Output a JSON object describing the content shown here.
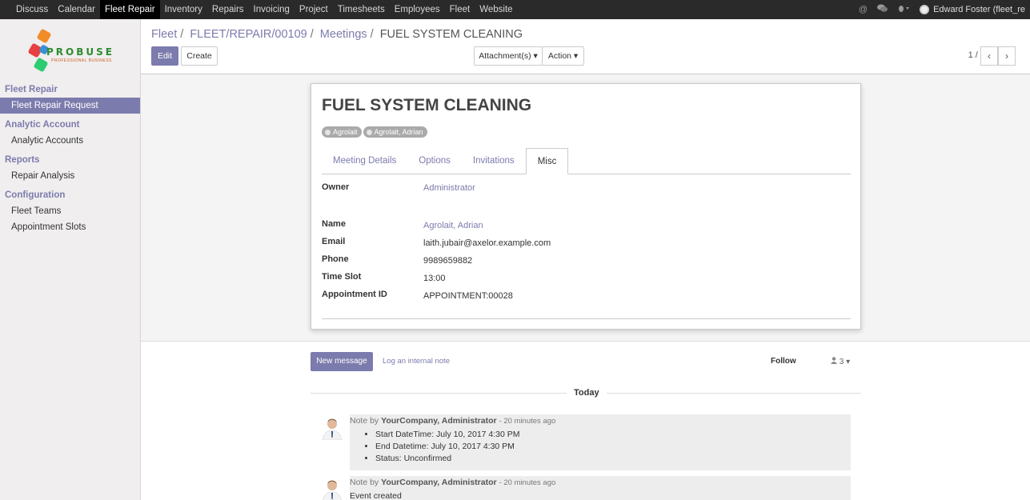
{
  "topbar": {
    "menu": [
      "Discuss",
      "Calendar",
      "Fleet Repair",
      "Inventory",
      "Repairs",
      "Invoicing",
      "Project",
      "Timesheets",
      "Employees",
      "Fleet",
      "Website"
    ],
    "user": "Edward Foster (fleet_re"
  },
  "logo": {
    "brand": "PROBUSE",
    "tagline": "PROFESSIONAL BUSINESS"
  },
  "sidebar": {
    "sections": [
      {
        "title": "Fleet Repair",
        "items": [
          "Fleet Repair Request"
        ]
      },
      {
        "title": "Analytic Account",
        "items": [
          "Analytic Accounts"
        ]
      },
      {
        "title": "Reports",
        "items": [
          "Repair Analysis"
        ]
      },
      {
        "title": "Configuration",
        "items": [
          "Fleet Teams",
          "Appointment Slots"
        ]
      }
    ]
  },
  "breadcrumb": {
    "c1": "Fleet",
    "c2": "FLEET/REPAIR/00109",
    "c3": "Meetings",
    "current": "FUEL SYSTEM CLEANING",
    "sep": "/"
  },
  "buttons": {
    "edit": "Edit",
    "create": "Create",
    "attachments": "Attachment(s) ▾",
    "action": "Action ▾"
  },
  "pager": "1 / 1",
  "record": {
    "title": "FUEL SYSTEM CLEANING",
    "tags": [
      "Agrolait",
      "Agrolait, Adrian"
    ],
    "tabs": [
      "Meeting Details",
      "Options",
      "Invitations",
      "Misc"
    ],
    "fields": {
      "owner_label": "Owner",
      "owner": "Administrator",
      "name_label": "Name",
      "name": "Agrolait, Adrian",
      "email_label": "Email",
      "email": "laith.jubair@axelor.example.com",
      "phone_label": "Phone",
      "phone": "9989659882",
      "slot_label": "Time Slot",
      "slot": "13:00",
      "appt_label": "Appointment ID",
      "appt": "APPOINTMENT:00028"
    }
  },
  "chatter": {
    "new_message": "New message",
    "log_note": "Log an internal note",
    "follow": "Follow",
    "followers": "3",
    "today": "Today",
    "messages": [
      {
        "prefix": "Note by",
        "author": "YourCompany, Administrator",
        "time": "- 20 minutes ago",
        "lines": [
          "Start DateTime: July 10, 2017 4:30 PM",
          "End Datetime: July 10, 2017 4:30 PM",
          "Status: Unconfirmed"
        ]
      },
      {
        "prefix": "Note by",
        "author": "YourCompany, Administrator",
        "time": "- 20 minutes ago",
        "body": "Event created"
      }
    ]
  }
}
